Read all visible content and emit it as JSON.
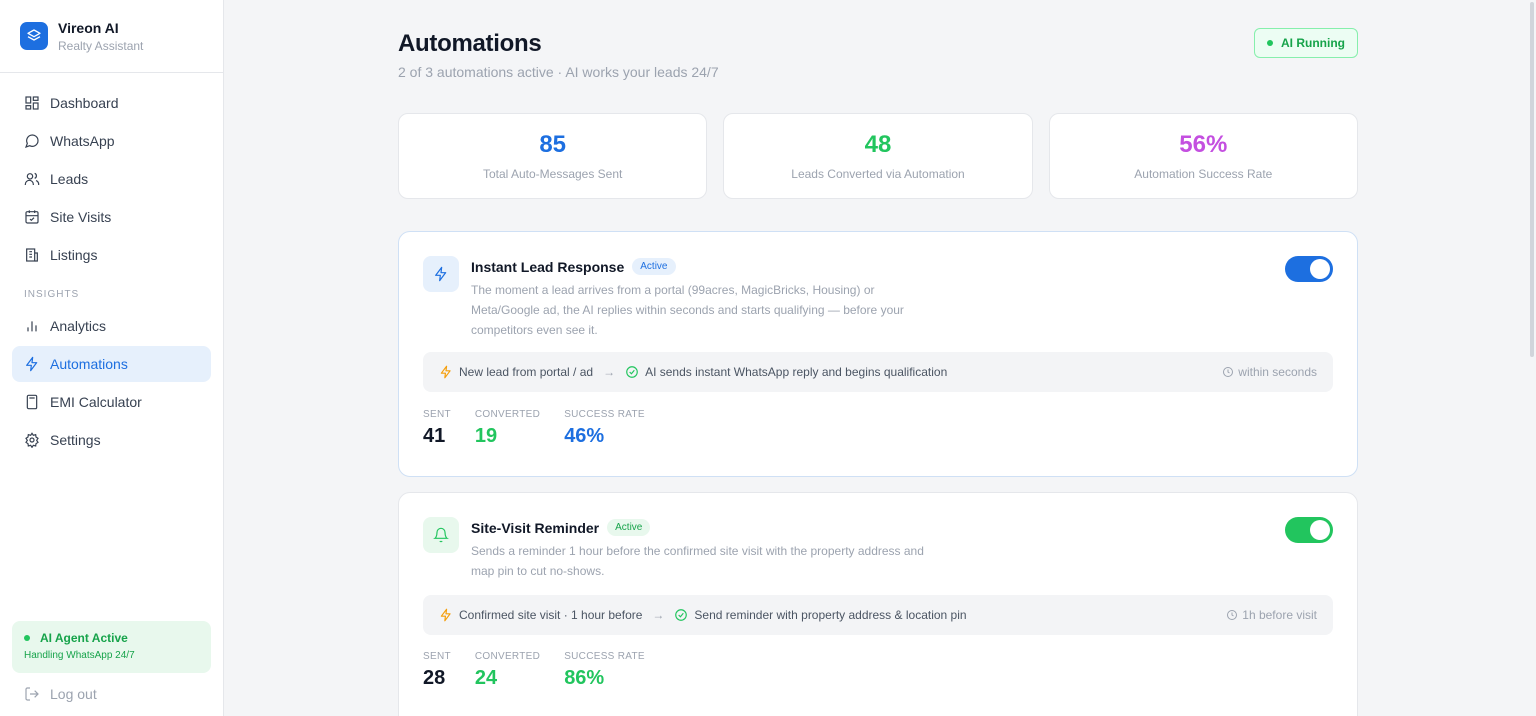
{
  "brand": {
    "name": "Vireon AI",
    "subtitle": "Realty Assistant"
  },
  "sidebar": {
    "items": [
      {
        "label": "Dashboard",
        "icon": "dashboard-icon"
      },
      {
        "label": "WhatsApp",
        "icon": "chat-bubble-icon"
      },
      {
        "label": "Leads",
        "icon": "users-icon"
      },
      {
        "label": "Site Visits",
        "icon": "calendar-icon"
      },
      {
        "label": "Listings",
        "icon": "building-icon"
      }
    ],
    "section_label": "INSIGHTS",
    "insights": [
      {
        "label": "Analytics",
        "icon": "bar-chart-icon"
      },
      {
        "label": "Automations",
        "icon": "lightning-icon",
        "active": true
      },
      {
        "label": "EMI Calculator",
        "icon": "calculator-icon"
      },
      {
        "label": "Settings",
        "icon": "gear-icon"
      }
    ],
    "agent": {
      "title": "AI Agent Active",
      "subtitle": "Handling WhatsApp 24/7"
    },
    "logout": "Log out"
  },
  "header": {
    "title": "Automations",
    "subtitle": "2 of 3 automations active · AI works your leads 24/7",
    "status": "AI Running"
  },
  "stats": [
    {
      "value": "85",
      "label": "Total Auto-Messages Sent",
      "color": "#1d6fe0"
    },
    {
      "value": "48",
      "label": "Leads Converted via Automation",
      "color": "#22c55e"
    },
    {
      "value": "56%",
      "label": "Automation Success Rate",
      "color": "#c44fe0"
    }
  ],
  "automations": [
    {
      "title": "Instant Lead Response",
      "badge": "Active",
      "description": "The moment a lead arrives from a portal (99acres, MagicBricks, Housing) or Meta/Google ad, the AI replies within seconds and starts qualifying — before your competitors even see it.",
      "trigger": "New lead from portal / ad",
      "action": "AI sends instant WhatsApp reply and begins qualification",
      "timing": "within seconds",
      "metrics": {
        "sent_label": "SENT",
        "sent": "41",
        "converted_label": "CONVERTED",
        "converted": "19",
        "rate_label": "SUCCESS RATE",
        "rate": "46%"
      },
      "toggle_on": true,
      "accent": "#1d6fe0"
    },
    {
      "title": "Site-Visit Reminder",
      "badge": "Active",
      "description": "Sends a reminder 1 hour before the confirmed site visit with the property address and map pin to cut no-shows.",
      "trigger": "Confirmed site visit · 1 hour before",
      "action": "Send reminder with property address & location pin",
      "timing": "1h before visit",
      "metrics": {
        "sent_label": "SENT",
        "sent": "28",
        "converted_label": "CONVERTED",
        "converted": "24",
        "rate_label": "SUCCESS RATE",
        "rate": "86%"
      },
      "toggle_on": true,
      "accent": "#22c55e"
    }
  ]
}
